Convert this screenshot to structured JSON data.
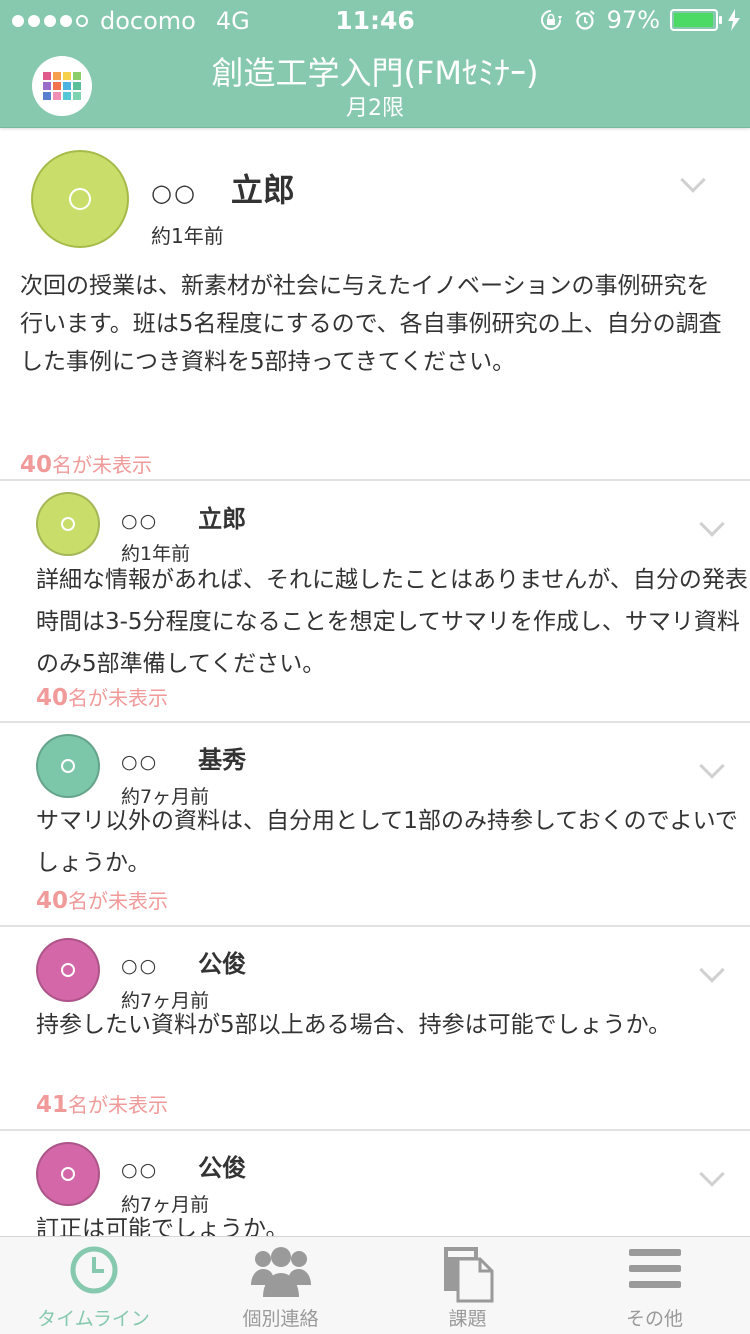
{
  "status_bar": {
    "carrier": "docomo",
    "network": "4G",
    "time": "11:46",
    "battery": "97%",
    "battery_level": 0.97,
    "signal_bars_filled": 4
  },
  "header": {
    "title": "創造工学入門(FMｾﾐﾅｰ)",
    "subtitle": "月2限",
    "app_icon_colors": [
      "#e05b8c",
      "#f6a04d",
      "#f5d14c",
      "#8ccf6a",
      "#9b6cc8",
      "#f3734f",
      "#4cb2e2",
      "#5bc09a",
      "#5a7fd0",
      "#ef8fb5",
      "#56c7d6",
      "#7fd4b0"
    ]
  },
  "colors": {
    "accent": "#86c9ae",
    "unread": "#f19a9a",
    "avatar_lime": "#c9de6a",
    "avatar_teal": "#7cc7aa",
    "avatar_pink": "#d367a8"
  },
  "main_post": {
    "avatar_color": "#c9de6a",
    "author_family": "○○",
    "author_given": "立郎",
    "time": "約1年前",
    "body": "次回の授業は、新素材が社会に与えたイノベーションの事例研究を行います。班は5名程度にするので、各自事例研究の上、自分の調査した事例につき資料を5部持ってきてください。",
    "unread_count": "40",
    "unread_suffix": "名が未表示"
  },
  "replies": [
    {
      "avatar_color": "#c9de6a",
      "author_family": "○○",
      "author_given": "立郎",
      "time": "約1年前",
      "body": "詳細な情報があれば、それに越したことはありませんが、自分の発表時間は3-5分程度になることを想定してサマリを作成し、サマリ資料のみ5部準備してください。",
      "unread_count": "40",
      "unread_suffix": "名が未表示"
    },
    {
      "avatar_color": "#7cc7aa",
      "author_family": "○○",
      "author_given": "基秀",
      "time": "約7ヶ月前",
      "body": "サマリ以外の資料は、自分用として1部のみ持参しておくのでよいでしょうか。",
      "unread_count": "40",
      "unread_suffix": "名が未表示"
    },
    {
      "avatar_color": "#d367a8",
      "author_family": "○○",
      "author_given": "公俊",
      "time": "約7ヶ月前",
      "body": "持参したい資料が5部以上ある場合、持参は可能でしょうか。",
      "unread_count": "41",
      "unread_suffix": "名が未表示"
    },
    {
      "avatar_color": "#d367a8",
      "author_family": "○○",
      "author_given": "公俊",
      "time": "約7ヶ月前",
      "body": "訂正は可能でしょうか。",
      "unread_count": "",
      "unread_suffix": ""
    }
  ],
  "tabs": [
    {
      "label": "タイムライン",
      "icon": "clock-icon",
      "active": true
    },
    {
      "label": "個別連絡",
      "icon": "people-icon",
      "active": false
    },
    {
      "label": "課題",
      "icon": "documents-icon",
      "active": false
    },
    {
      "label": "その他",
      "icon": "menu-icon",
      "active": false
    }
  ]
}
